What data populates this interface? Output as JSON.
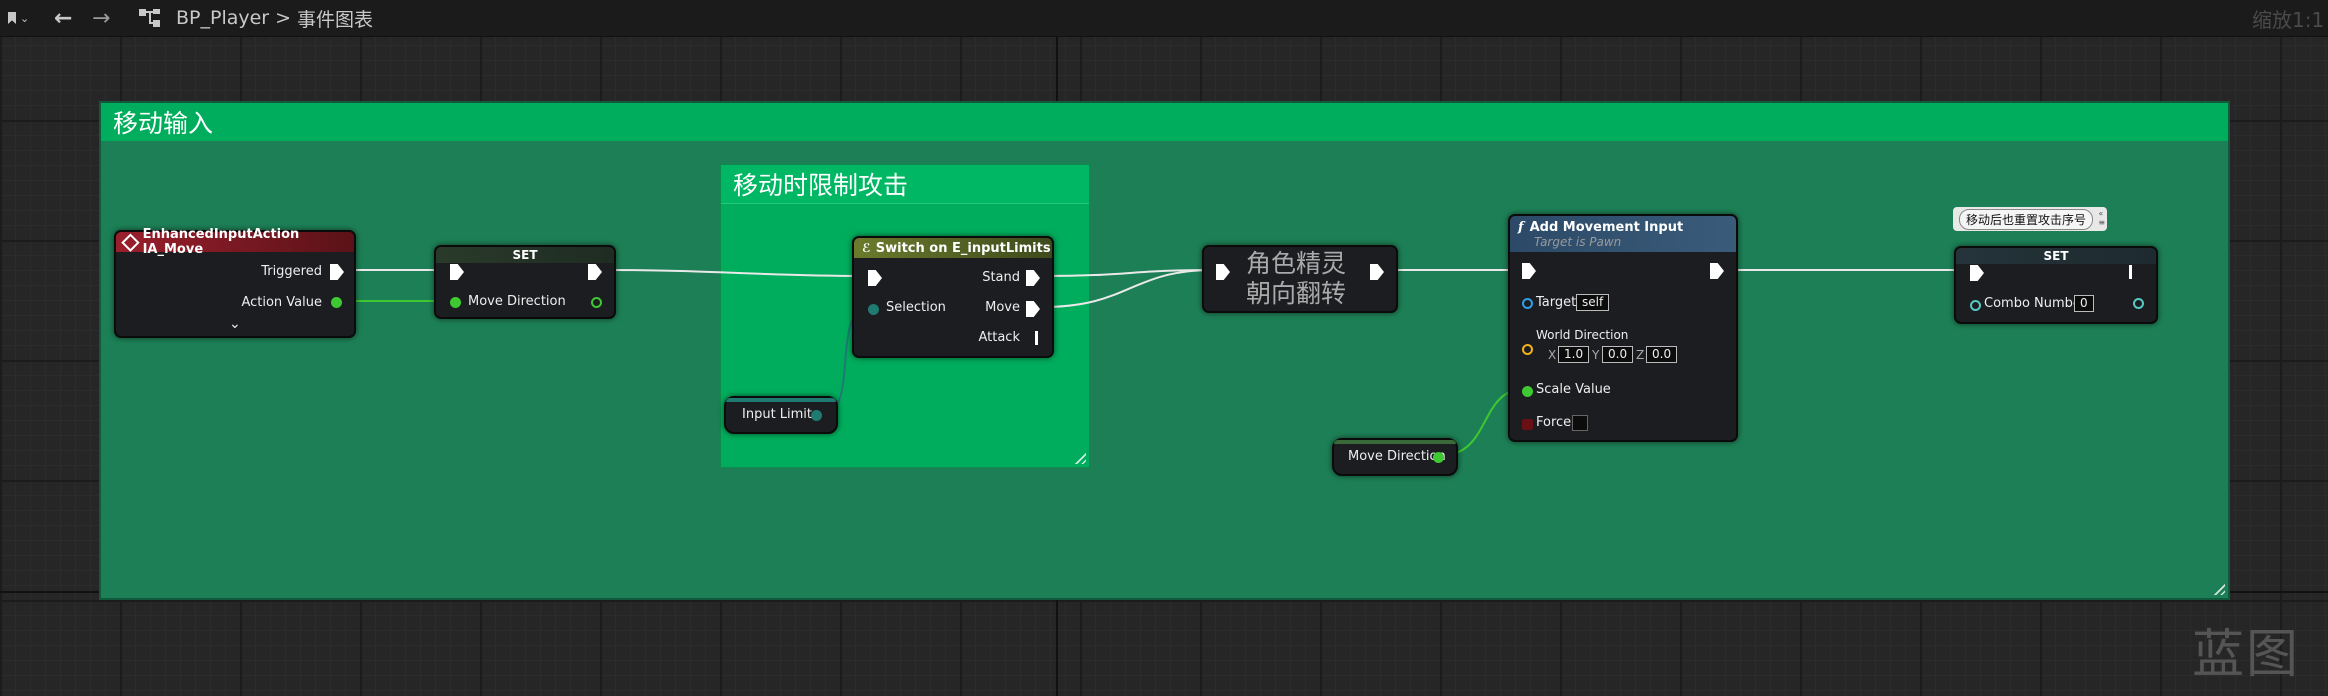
{
  "toolbar": {
    "back_label": "←",
    "forward_label": "→",
    "breadcrumb_blueprint": "BP_Player",
    "breadcrumb_separator": ">",
    "breadcrumb_graph": "事件图表",
    "zoom": "缩放1:1"
  },
  "watermark": "蓝图",
  "comments": {
    "move_input": "移动输入",
    "limit_attack": "移动时限制攻击",
    "flip_sprite_node": "角色精灵\n朝向翻转",
    "reset_combo_bubble": "移动后也重置攻击序号"
  },
  "nodes": {
    "input_action": {
      "title": "EnhancedInputAction IA_Move",
      "pin_triggered": "Triggered",
      "pin_action_value": "Action Value",
      "expand": "⌄"
    },
    "set_move_direction": {
      "title": "SET",
      "pin_variable": "Move Direction"
    },
    "switch": {
      "title": "Switch on E_inputLimits",
      "pin_selection": "Selection",
      "pin_stand": "Stand",
      "pin_move": "Move",
      "pin_attack": "Attack"
    },
    "input_limits_getter": {
      "label": "Input Limits"
    },
    "add_movement_input": {
      "title": "Add Movement Input",
      "subtitle": "Target is Pawn",
      "pin_target": "Target",
      "target_value": "self",
      "pin_world_direction": "World Direction",
      "x_label": "X",
      "x_value": "1.0",
      "y_label": "Y",
      "y_value": "0.0",
      "z_label": "Z",
      "z_value": "0.0",
      "pin_scale_value": "Scale Value",
      "pin_force": "Force"
    },
    "move_direction_getter": {
      "label": "Move Direction"
    },
    "set_combo": {
      "title": "SET",
      "pin_variable": "Combo Number",
      "value": "0"
    }
  },
  "colors": {
    "graph_background": "#262626",
    "comment_green": "#00a95c",
    "comment_body": "#1d7f55",
    "event_header": "#7a1a22",
    "function_header": "#3a5a7a",
    "switch_header": "#6a7a2a",
    "vector_pin": "#3ec832",
    "exec_pin": "#ffffff"
  }
}
